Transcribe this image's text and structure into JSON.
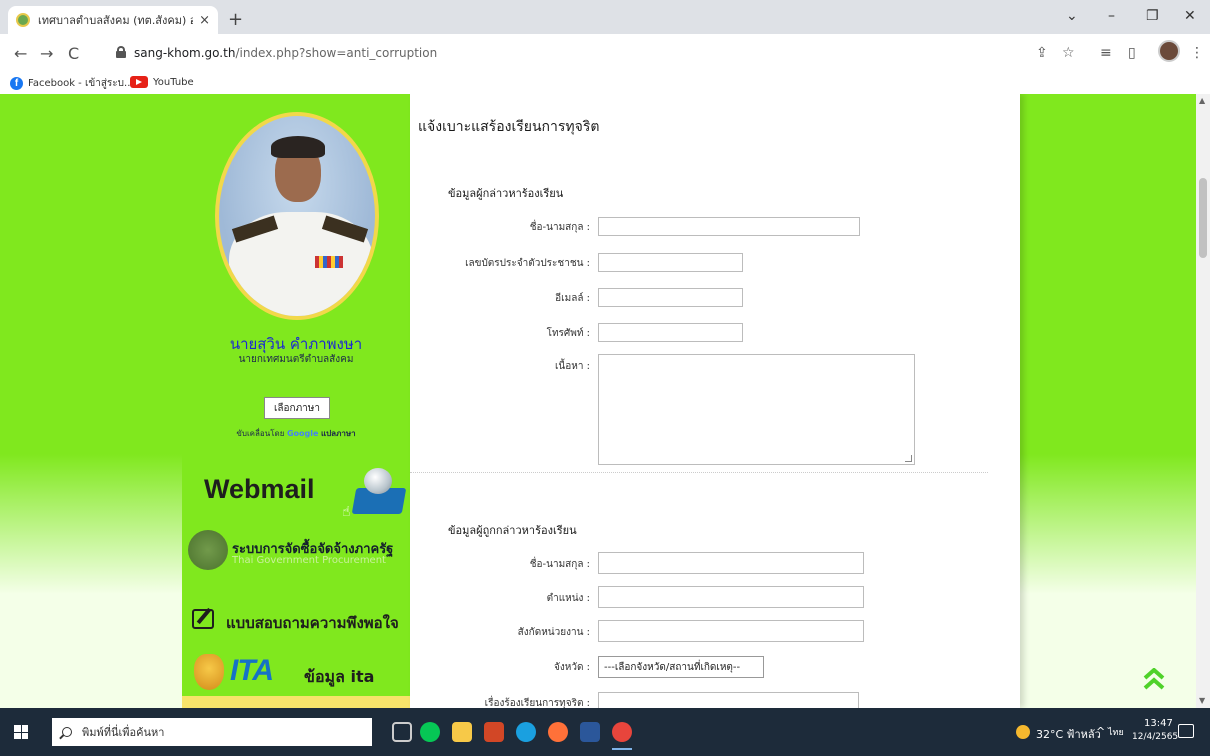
{
  "browser": {
    "tab_title": "เทศบาลตำบลสังคม (ทต.สังคม) อำเภอ",
    "tab_close": "×",
    "new_tab": "+",
    "url_domain": "sang-khom.go.th",
    "url_path": "/index.php?show=anti_corruption",
    "nav": {
      "back": "←",
      "forward": "→",
      "reload": "C"
    },
    "window": {
      "dropdown": "⌄",
      "minimize": "–",
      "maximize": "❐",
      "close": "✕"
    },
    "toolbar": {
      "share": "⇪",
      "star": "☆",
      "reading_list": "≡",
      "sidepanel": "▯",
      "menu": "⋮"
    },
    "bookmarks": [
      {
        "label": "Facebook - เข้าสู่ระบ...",
        "icon": "facebook-icon"
      },
      {
        "label": "YouTube",
        "icon": "youtube-icon"
      }
    ]
  },
  "sidebar": {
    "mayor_name": "นายสุวิน คำภาพงษา",
    "mayor_title": "นายกเทศมนตรีตำบลสังคม",
    "language_button": "เลือกภาษา",
    "google_prefix": "ขับเคลื่อนโดย",
    "google_brand": "Google",
    "google_translate": "แปลภาษา",
    "webmail": "Webmail",
    "gprocurement_title": "ระบบการจัดซื้อจัดจ้างภาครัฐ",
    "gprocurement_subtitle": "Thai Government Procurement",
    "survey_label": "แบบสอบถามความพึงพอใจ",
    "ita_logo": "ITA",
    "ita_label": "ข้อมูล ita"
  },
  "form": {
    "page_title": "แจ้งเบาะแสร้องเรียนการทุจริต",
    "complainant_section": "ข้อมูลผู้กล่าวหาร้องเรียน",
    "complainant_fields": [
      {
        "label": "ชื่อ-นามสกุล :",
        "value": ""
      },
      {
        "label": "เลขบัตรประจำตัวประชาชน :",
        "value": ""
      },
      {
        "label": "อีเมลล์ :",
        "value": ""
      },
      {
        "label": "โทรศัพท์ :",
        "value": ""
      }
    ],
    "content_label": "เนื้อหา :",
    "accused_section": "ข้อมูลผู้ถูกกล่าวหาร้องเรียน",
    "accused_fields": [
      {
        "label": "ชื่อ-นามสกุล :",
        "value": ""
      },
      {
        "label": "ตำแหน่ง :",
        "value": ""
      },
      {
        "label": "สังกัดหน่วยงาน :",
        "value": ""
      }
    ],
    "province_label": "จังหวัด :",
    "province_select": "---เลือกจังหวัด/สถานที่เกิดเหตุ--",
    "subject_label": "เรื่องร้องเรียนการทุจริต :",
    "back_to_top": "≈"
  },
  "taskbar": {
    "search_placeholder": "พิมพ์ที่นี่เพื่อค้นหา",
    "weather": "32°C ฟ้าหลัว",
    "language": "ไทย",
    "time": "13:47",
    "date": "12/4/2565"
  }
}
